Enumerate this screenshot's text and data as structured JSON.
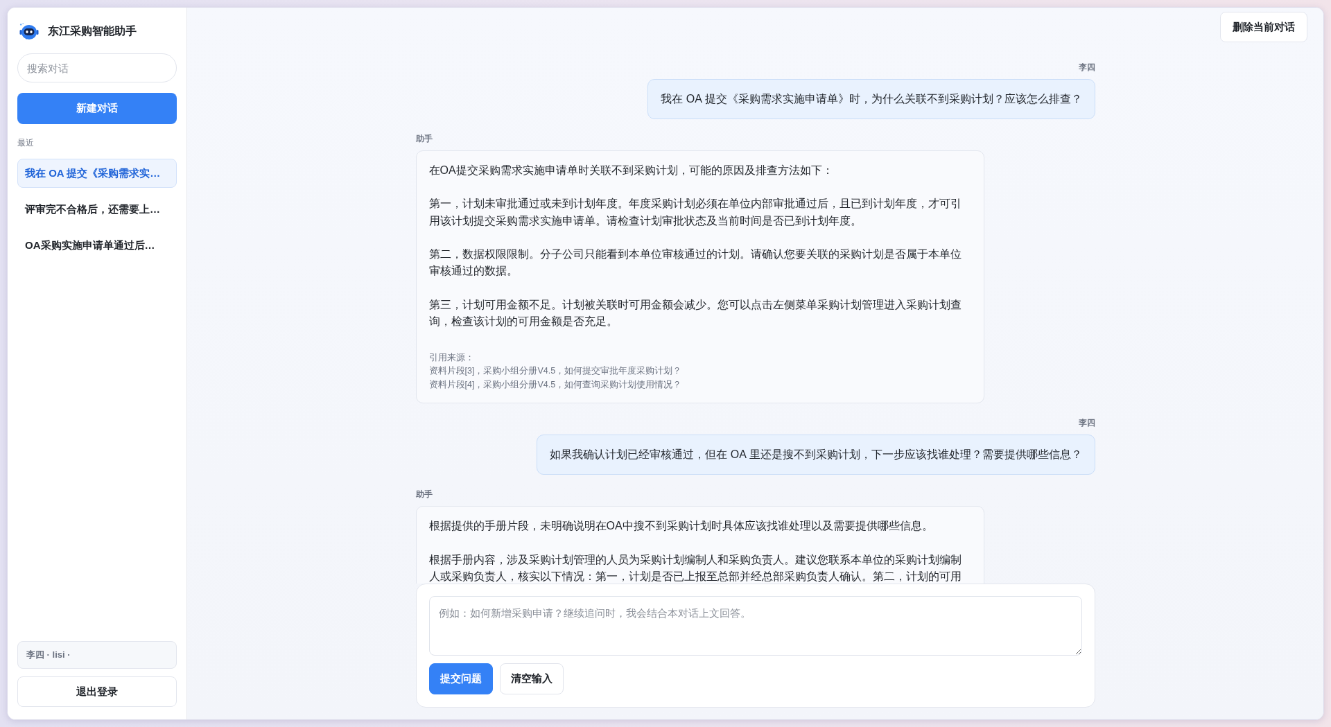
{
  "sidebar": {
    "app_title": "东江采购智能助手",
    "search": {
      "placeholder": "搜索对话"
    },
    "new_chat_button": "新建对话",
    "section_label": "最近",
    "conversations": [
      {
        "title": "我在 OA 提交《采购需求实…",
        "selected": true
      },
      {
        "title": "评审完不合格后，还需要上…",
        "selected": false
      },
      {
        "title": "OA采购实施申请单通过后…",
        "selected": false
      }
    ],
    "user_info": "李四 · lisi ·",
    "logout_button": "退出登录"
  },
  "header": {
    "delete_button": "删除当前对话"
  },
  "messages": [
    {
      "kind": "user",
      "sender": "李四",
      "text": "我在 OA 提交《采购需求实施申请单》时，为什么关联不到采购计划？应该怎么排查？"
    },
    {
      "kind": "assistant",
      "sender": "助手",
      "paragraphs": [
        "在OA提交采购需求实施申请单时关联不到采购计划，可能的原因及排查方法如下：",
        "第一，计划未审批通过或未到计划年度。年度采购计划必须在单位内部审批通过后，且已到计划年度，才可引用该计划提交采购需求实施申请单。请检查计划审批状态及当前时间是否已到计划年度。",
        "第二，数据权限限制。分子公司只能看到本单位审核通过的计划。请确认您要关联的采购计划是否属于本单位审核通过的数据。",
        "第三，计划可用金额不足。计划被关联时可用金额会减少。您可以点击左侧菜单采购计划管理进入采购计划查询，检查该计划的可用金额是否充足。"
      ],
      "sources": {
        "label": "引用来源：",
        "items": [
          "资料片段[3]，采购小组分册V4.5，如何提交审批年度采购计划？",
          "资料片段[4]，采购小组分册V4.5，如何查询采购计划使用情况？"
        ]
      }
    },
    {
      "kind": "user",
      "sender": "李四",
      "text": "如果我确认计划已经审核通过，但在 OA 里还是搜不到采购计划，下一步应该找谁处理？需要提供哪些信息？"
    },
    {
      "kind": "assistant",
      "sender": "助手",
      "paragraphs": [
        "根据提供的手册片段，未明确说明在OA中搜不到采购计划时具体应该找谁处理以及需要提供哪些信息。",
        "根据手册内容，涉及采购计划管理的人员为采购计划编制人和采购负责人。建议您联系本单位的采购计划编制人或采购负责人，核实以下情况：第一，计划是否已上报至总部并经总部采购负责人确认。第二，计划的可用"
      ]
    }
  ],
  "composer": {
    "placeholder": "例如：如何新增采购申请？继续追问时，我会结合本对话上文回答。",
    "buttons": [
      {
        "label": "提交问题",
        "kind": "primary"
      },
      {
        "label": "清空输入",
        "kind": "secondary"
      }
    ]
  }
}
